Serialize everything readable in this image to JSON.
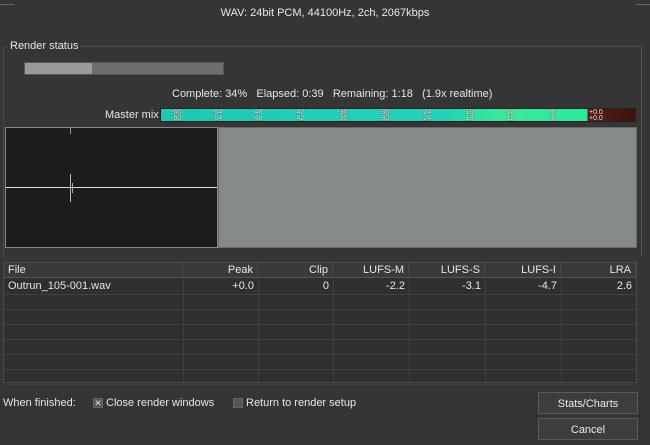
{
  "format": "WAV: 24bit PCM, 44100Hz, 2ch, 2067kbps",
  "render_status": {
    "group_label": "Render status",
    "progress_fraction": 0.34,
    "stats": "Complete: 34%   Elapsed: 0:39   Remaining: 1:18   (1.9x realtime)"
  },
  "meter": {
    "label": "Master mix",
    "ticks_top": [
      "-60",
      "-54",
      "-48",
      "-42",
      "-36",
      "-30",
      "-24",
      "-18",
      "-12",
      "-6",
      "+0.0"
    ],
    "ticks_bottom": [
      "-60",
      "-54",
      "-48",
      "-42",
      "-36",
      "-30",
      "-24",
      "-18",
      "-12",
      "-6",
      "+0.0"
    ]
  },
  "table": {
    "columns": [
      "File",
      "Peak",
      "Clip",
      "LUFS-M",
      "LUFS-S",
      "LUFS-I",
      "LRA"
    ],
    "rows": [
      [
        "Outrun_105-001.wav",
        "+0.0",
        "0",
        "-2.2",
        "-3.1",
        "-4.7",
        "2.6"
      ]
    ]
  },
  "footer": {
    "when_finished": "When finished:",
    "close_windows": "Close render windows",
    "close_windows_checked": true,
    "return_setup": "Return to render setup",
    "return_setup_checked": false,
    "stats_button": "Stats/Charts",
    "cancel_button": "Cancel"
  },
  "colors": {
    "background": "#353535",
    "meter_fill": "#22d3b8",
    "meter_clip": "#3a140e"
  }
}
